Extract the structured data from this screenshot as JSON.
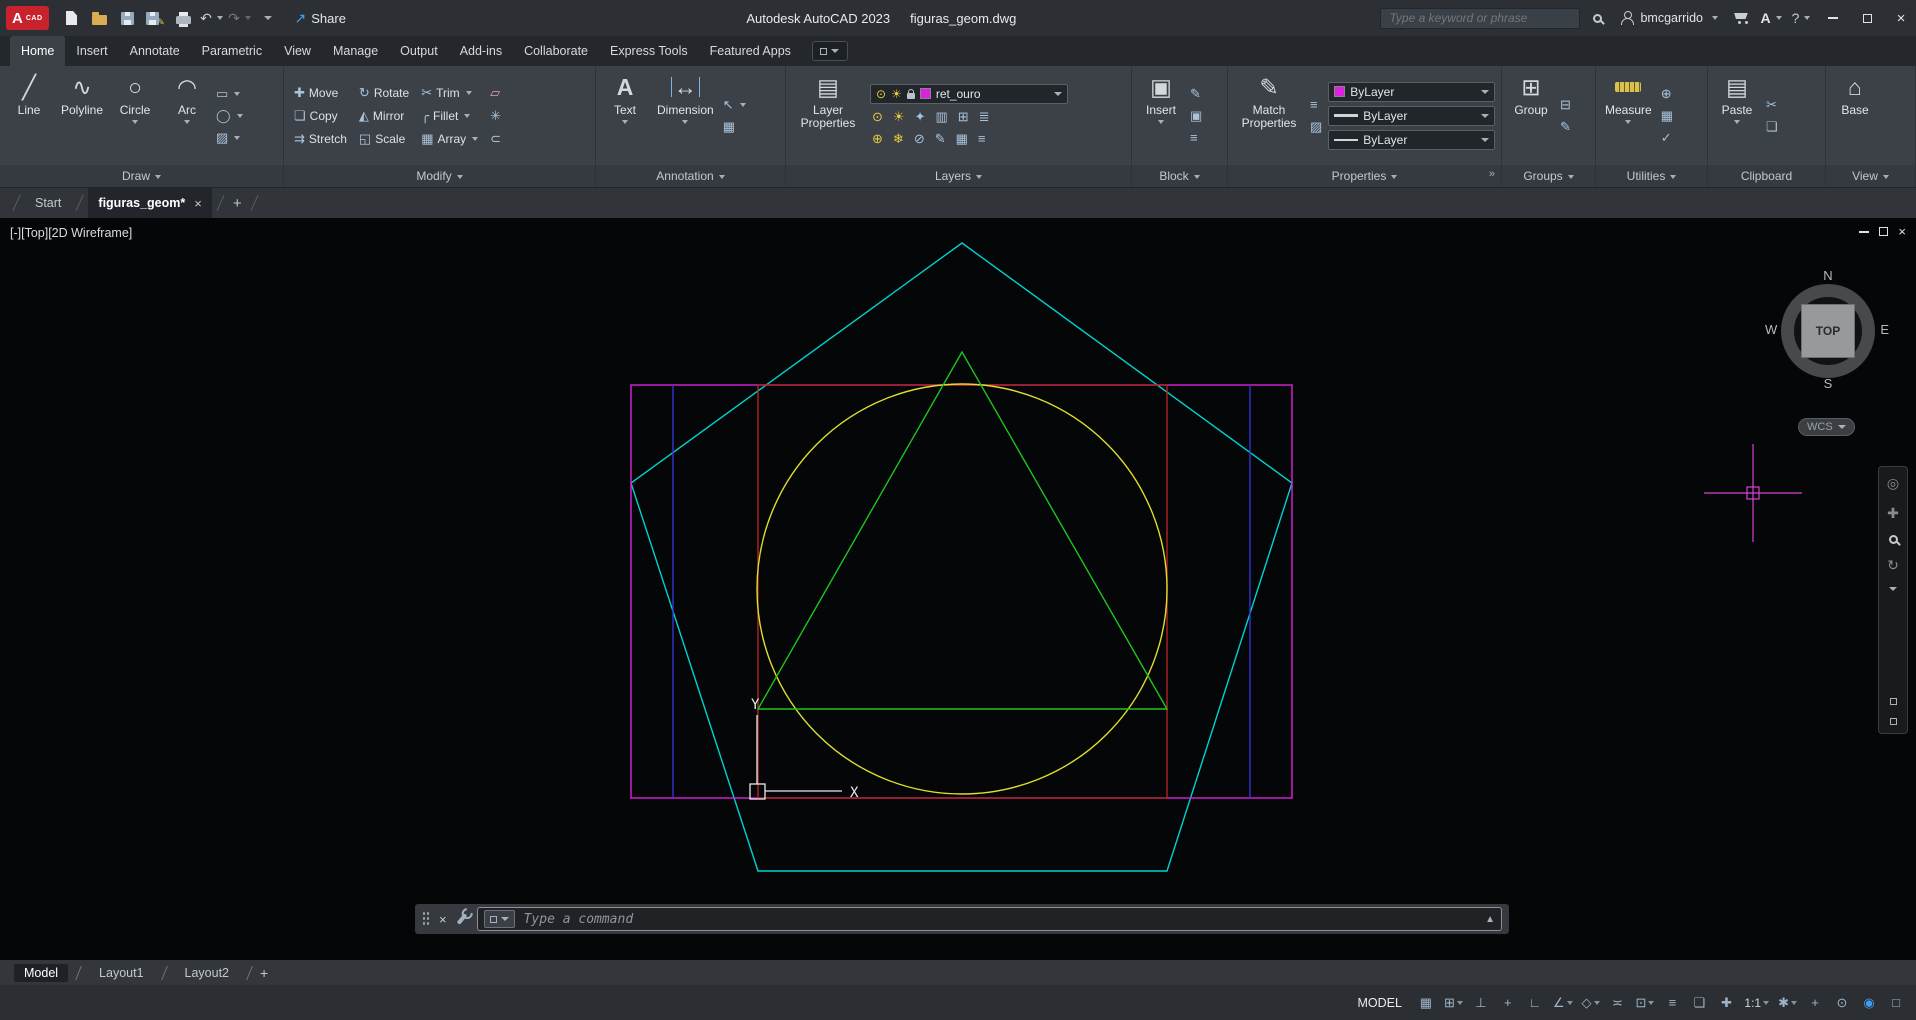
{
  "titlebar": {
    "logo": {
      "letter": "A",
      "word": "CAD"
    },
    "share_label": "Share",
    "app_title": "Autodesk AutoCAD 2023",
    "doc_title": "figuras_geom.dwg",
    "search_placeholder": "Type a keyword or phrase",
    "username": "bmcgarrido",
    "autodesk_badge": "A",
    "help_label": "?"
  },
  "ribbon": {
    "tabs": [
      "Home",
      "Insert",
      "Annotate",
      "Parametric",
      "View",
      "Manage",
      "Output",
      "Add-ins",
      "Collaborate",
      "Express Tools",
      "Featured Apps"
    ],
    "draw": {
      "label": "Draw",
      "line": "Line",
      "polyline": "Polyline",
      "circle": "Circle",
      "arc": "Arc"
    },
    "modify": {
      "label": "Modify",
      "move": "Move",
      "rotate": "Rotate",
      "trim": "Trim",
      "copy": "Copy",
      "mirror": "Mirror",
      "fillet": "Fillet",
      "stretch": "Stretch",
      "scale": "Scale",
      "array": "Array"
    },
    "annotation": {
      "label": "Annotation",
      "text": "Text",
      "dimension": "Dimension"
    },
    "layers": {
      "label": "Layers",
      "layer_properties": "Layer Properties",
      "current_layer": "ret_ouro"
    },
    "block": {
      "label": "Block",
      "insert": "Insert"
    },
    "properties": {
      "label": "Properties",
      "match_properties": "Match Properties",
      "color": "ByLayer",
      "lineweight": "ByLayer",
      "linetype": "ByLayer"
    },
    "groups": {
      "label": "Groups",
      "group": "Group"
    },
    "utilities": {
      "label": "Utilities",
      "measure": "Measure"
    },
    "clipboard": {
      "label": "Clipboard",
      "paste": "Paste"
    },
    "view": {
      "label": "View",
      "base": "Base"
    }
  },
  "file_tabs": {
    "start": "Start",
    "active_doc": "figuras_geom*"
  },
  "canvas": {
    "viewport_label": "[-][Top][2D Wireframe]",
    "viewcube": {
      "n": "N",
      "s": "S",
      "w": "W",
      "e": "E",
      "top": "TOP"
    },
    "wcs_label": "WCS",
    "ucs": {
      "x": "X",
      "y": "Y"
    },
    "colors": {
      "background": "#050607",
      "pentagon": "#00d2d2",
      "golden_rectangle": "#dd22dd",
      "inner_square": "#b02525",
      "guide_lines": "#3535cf",
      "circle": "#dede2e",
      "triangle": "#1ec41e"
    }
  },
  "command_line": {
    "placeholder": "Type a command"
  },
  "layout_tabs": {
    "model": "Model",
    "layout1": "Layout1",
    "layout2": "Layout2"
  },
  "status": {
    "model_label": "MODEL",
    "scale": "1:1"
  },
  "theme": {
    "logo_red": "#c8232c",
    "accent_blue": "#3e9df0",
    "crosshair": "#d643d6",
    "ucs_icon": "#e9e9e9",
    "layer_swatch_style": "background:#dd22dd",
    "line_swatch_style": "background:#cfd4da"
  },
  "icons": {
    "line": "╱",
    "polyline": "∿",
    "circle": "○",
    "arc": "◠",
    "rectangle": "▭",
    "ellipse": "◯",
    "hatch": "▨",
    "move": "✚",
    "rotate": "↻",
    "trim": "✂",
    "copy": "❏",
    "mirror": "◭",
    "fillet": "╭",
    "stretch": "⇉",
    "scale": "◱",
    "array": "▦",
    "erase": "▱",
    "explode": "✳",
    "offset": "⊂",
    "text": "A",
    "dimension": "↔",
    "leader": "↖",
    "table": "▦",
    "layer_properties": "▤",
    "insert": "▣",
    "match_properties": "✎",
    "group": "⊞",
    "ungroup": "⊟",
    "edit": "✎",
    "idpoint": "⊕",
    "calc": "▦",
    "check": "✓",
    "cut": "✂",
    "paste": "▤",
    "base": "⌂",
    "launcher": "»",
    "bulb": "⊙",
    "sun": "☀",
    "layer_tools": [
      "⊙",
      "☀",
      "✦",
      "▥",
      "⊞",
      "≣",
      "⊕",
      "❄",
      "⊘",
      "✎",
      "▦",
      "≡"
    ],
    "undo": "↶",
    "redo": "↷",
    "share": "↗",
    "close": "×",
    "up": "▲",
    "plus": "+",
    "wheel": "◎",
    "grid": "▦",
    "snap": "⊞",
    "infer": "⊥",
    "ortho": "∟",
    "polar": "∠",
    "iso": "◇",
    "otrack": "≍",
    "osnap": "⊡",
    "lineweight": "≡",
    "cycling": "❏",
    "gizmo": "✚",
    "workspace": "✱",
    "isolate": "⊙",
    "graphics": "◉",
    "cleanscreen": "□"
  }
}
